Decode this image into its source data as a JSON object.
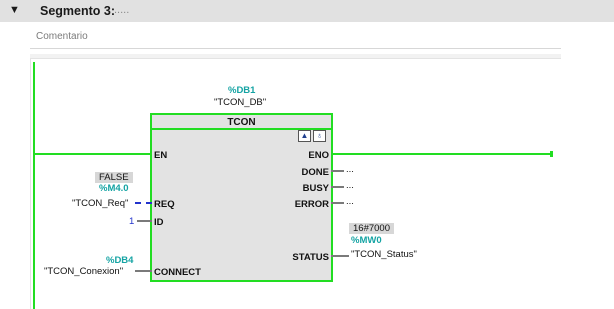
{
  "segment": {
    "toggle_glyph": "▼",
    "title": "Segmento 3:",
    "title_suffix": ".....",
    "comment_placeholder": "Comentario"
  },
  "instance": {
    "address": "%DB1",
    "name": "\"TCON_DB\""
  },
  "block": {
    "type": "TCON",
    "icon_1": "▲",
    "icon_2": "♁",
    "inputs": {
      "en": "EN",
      "req": "REQ",
      "id": "ID",
      "connect": "CONNECT"
    },
    "outputs": {
      "eno": "ENO",
      "done": "DONE",
      "busy": "BUSY",
      "error": "ERROR",
      "status": "STATUS"
    }
  },
  "operands": {
    "req_value": "FALSE",
    "req_address": "%M4.0",
    "req_name": "\"TCON_Req\"",
    "id_value": "1",
    "connect_address": "%DB4",
    "connect_name": "\"TCON_Conexion\"",
    "done_out": "...",
    "busy_out": "...",
    "error_out": "...",
    "status_value": "16#7000",
    "status_address": "%MW0",
    "status_name": "\"TCON_Status\""
  },
  "colors": {
    "wire_green": "#22dd22",
    "address_teal": "#14a3a3",
    "dashed_wire_blue": "#2233cc",
    "block_fill": "#e3e3e3",
    "header_bg": "#e1e1e1"
  }
}
